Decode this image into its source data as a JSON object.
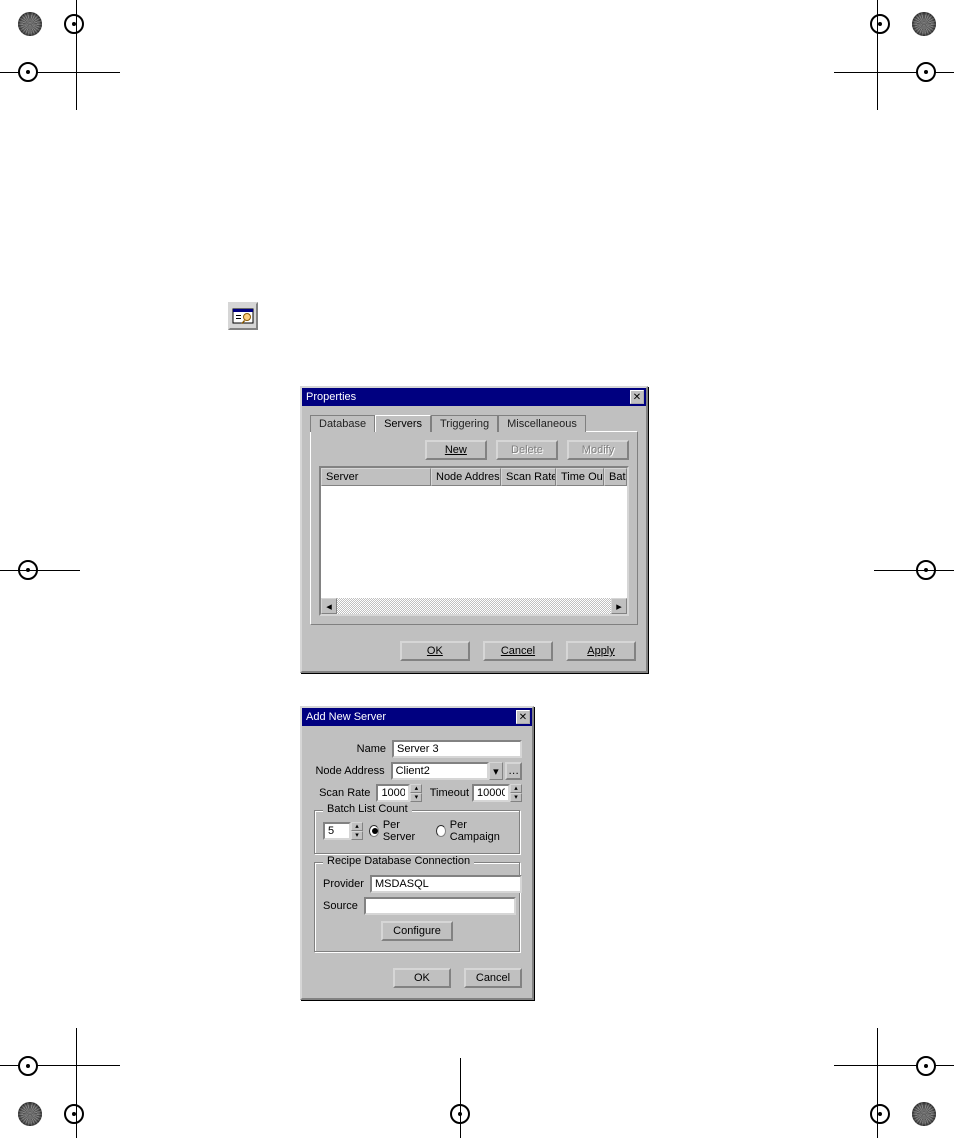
{
  "props": {
    "title": "Properties",
    "tabs": {
      "database": "Database",
      "servers": "Servers",
      "triggering": "Triggering",
      "misc": "Miscellaneous"
    },
    "toolbar": {
      "new": "New",
      "delete": "Delete",
      "modify": "Modify"
    },
    "cols": {
      "server": "Server",
      "node": "Node Address",
      "scan": "Scan Rate",
      "timeout": "Time Out",
      "batch": "Batch List..."
    },
    "footer": {
      "ok": "OK",
      "cancel": "Cancel",
      "apply": "Apply"
    }
  },
  "addsrv": {
    "title": "Add New Server",
    "labels": {
      "name": "Name",
      "node": "Node Address",
      "scan": "Scan Rate",
      "timeout": "Timeout"
    },
    "values": {
      "name": "Server 3",
      "node": "Client2",
      "scan": "1000",
      "timeout": "10000"
    },
    "batch": {
      "legend": "Batch List Count",
      "value": "5",
      "per_server": "Per Server",
      "per_campaign": "Per Campaign"
    },
    "recipe": {
      "legend": "Recipe Database Connection",
      "provider_lbl": "Provider",
      "provider_val": "MSDASQL",
      "source_lbl": "Source",
      "source_val": "",
      "configure": "Configure"
    },
    "footer": {
      "ok": "OK",
      "cancel": "Cancel"
    }
  }
}
